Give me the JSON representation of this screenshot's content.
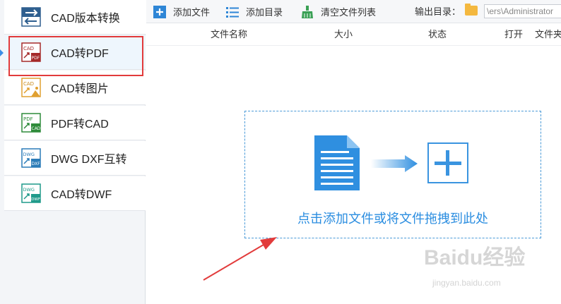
{
  "sidebar": {
    "items": [
      {
        "label": "CAD版本转换",
        "icon": "cad-version-convert-icon",
        "icon_text": ""
      },
      {
        "label": "CAD转PDF",
        "icon": "cad-to-pdf-icon",
        "icon_text": "CAD",
        "icon_text2": "PDF"
      },
      {
        "label": "CAD转图片",
        "icon": "cad-to-image-icon",
        "icon_text": "CAD"
      },
      {
        "label": "PDF转CAD",
        "icon": "pdf-to-cad-icon",
        "icon_text": "PDF",
        "icon_text2": "CAD"
      },
      {
        "label": "DWG DXF互转",
        "icon": "dwg-dxf-convert-icon",
        "icon_text": "DWG",
        "icon_text2": "DXF"
      },
      {
        "label": "CAD转DWF",
        "icon": "cad-to-dwf-icon",
        "icon_text": "DWG",
        "icon_text2": "DWF"
      }
    ],
    "active_index": 1
  },
  "toolbar": {
    "add_file": "添加文件",
    "add_dir": "添加目录",
    "clear_list": "清空文件列表",
    "output_dir_label": "输出目录：",
    "output_dir_value": "ers\\Administrator\\"
  },
  "table": {
    "columns": [
      "文件名称",
      "大小",
      "状态",
      "打开",
      "文件夹"
    ]
  },
  "dropzone": {
    "text": "点击添加文件或将文件拖拽到此处"
  },
  "watermark": {
    "logo": "Baidu经验",
    "url": "jingyan.baidu.com"
  },
  "colors": {
    "accent": "#2a8de0",
    "highlight_border": "#e23b3b",
    "folder": "#f4b83f"
  }
}
